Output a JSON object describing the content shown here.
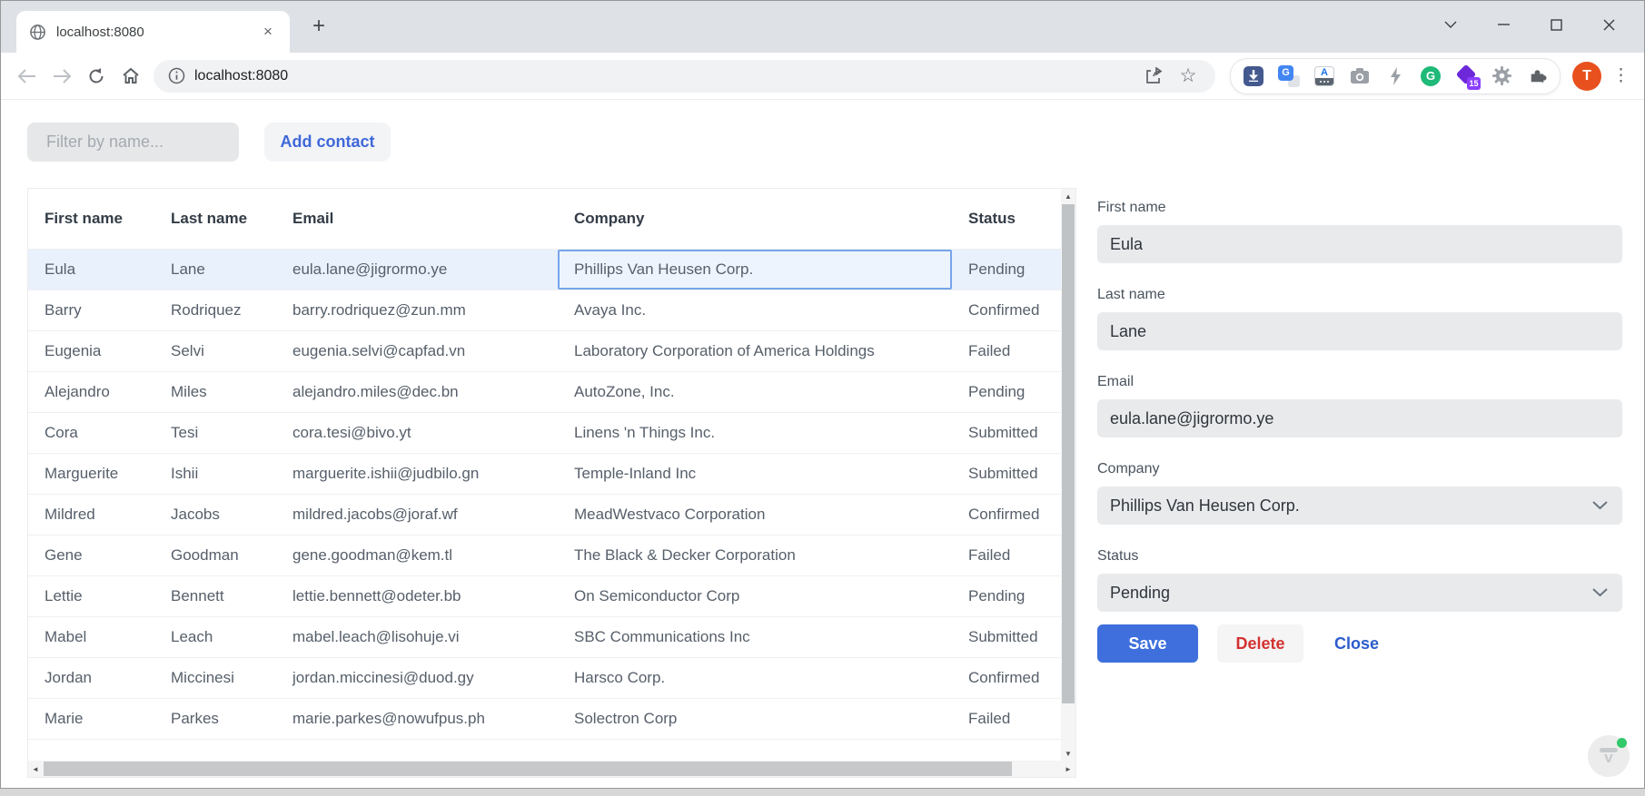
{
  "browser": {
    "tab_title": "localhost:8080",
    "url": "localhost:8080"
  },
  "icons": {
    "tab_close": "×",
    "new_tab": "+",
    "menu_dots": "⋮",
    "star": "☆",
    "info_letter": "i",
    "translate_letter": "G",
    "keyboard_letter": "A",
    "grammarly_letter": "G",
    "edu_badge_count": "15",
    "avatar_letter": "T",
    "scroll_up": "▲",
    "scroll_down": "▼",
    "scroll_left": "◄",
    "scroll_right": "►",
    "assistant_letter": "v"
  },
  "controls": {
    "filter_placeholder": "Filter by name...",
    "add_contact_label": "Add contact"
  },
  "table": {
    "headers": [
      "First name",
      "Last name",
      "Email",
      "Company",
      "Status"
    ],
    "column_keys": [
      "first-name",
      "last-name",
      "email",
      "company",
      "status"
    ],
    "rows": [
      [
        "Eula",
        "Lane",
        "eula.lane@jigrormo.ye",
        "Phillips Van Heusen Corp.",
        "Pending"
      ],
      [
        "Barry",
        "Rodriquez",
        "barry.rodriquez@zun.mm",
        "Avaya Inc.",
        "Confirmed"
      ],
      [
        "Eugenia",
        "Selvi",
        "eugenia.selvi@capfad.vn",
        "Laboratory Corporation of America Holdings",
        "Failed"
      ],
      [
        "Alejandro",
        "Miles",
        "alejandro.miles@dec.bn",
        "AutoZone, Inc.",
        "Pending"
      ],
      [
        "Cora",
        "Tesi",
        "cora.tesi@bivo.yt",
        "Linens 'n Things Inc.",
        "Submitted"
      ],
      [
        "Marguerite",
        "Ishii",
        "marguerite.ishii@judbilo.gn",
        "Temple-Inland Inc",
        "Submitted"
      ],
      [
        "Mildred",
        "Jacobs",
        "mildred.jacobs@joraf.wf",
        "MeadWestvaco Corporation",
        "Confirmed"
      ],
      [
        "Gene",
        "Goodman",
        "gene.goodman@kem.tl",
        "The Black & Decker Corporation",
        "Failed"
      ],
      [
        "Lettie",
        "Bennett",
        "lettie.bennett@odeter.bb",
        "On Semiconductor Corp",
        "Pending"
      ],
      [
        "Mabel",
        "Leach",
        "mabel.leach@lisohuje.vi",
        "SBC Communications Inc",
        "Submitted"
      ],
      [
        "Jordan",
        "Miccinesi",
        "jordan.miccinesi@duod.gy",
        "Harsco Corp.",
        "Confirmed"
      ],
      [
        "Marie",
        "Parkes",
        "marie.parkes@nowufpus.ph",
        "Solectron Corp",
        "Failed"
      ]
    ],
    "selected_row_index": 0,
    "selected_cell_column": "company"
  },
  "form": {
    "fields": [
      {
        "key": "first-name",
        "label": "First name",
        "value": "Eula",
        "type": "text"
      },
      {
        "key": "last-name",
        "label": "Last name",
        "value": "Lane",
        "type": "text"
      },
      {
        "key": "email",
        "label": "Email",
        "value": "eula.lane@jigrormo.ye",
        "type": "text"
      },
      {
        "key": "company",
        "label": "Company",
        "value": "Phillips Van Heusen Corp.",
        "type": "select"
      },
      {
        "key": "status",
        "label": "Status",
        "value": "Pending",
        "type": "select"
      }
    ],
    "buttons": {
      "save": "Save",
      "delete": "Delete",
      "close": "Close"
    }
  },
  "colors": {
    "accent_blue": "#3e6fdd",
    "link_blue": "#3f68d9",
    "delete_red": "#d43131",
    "selected_row_bg": "#e9f1fd",
    "selected_cell_border": "#77a5ea",
    "avatar_orange": "#e8501e",
    "online_dot_green": "#22c55e"
  }
}
